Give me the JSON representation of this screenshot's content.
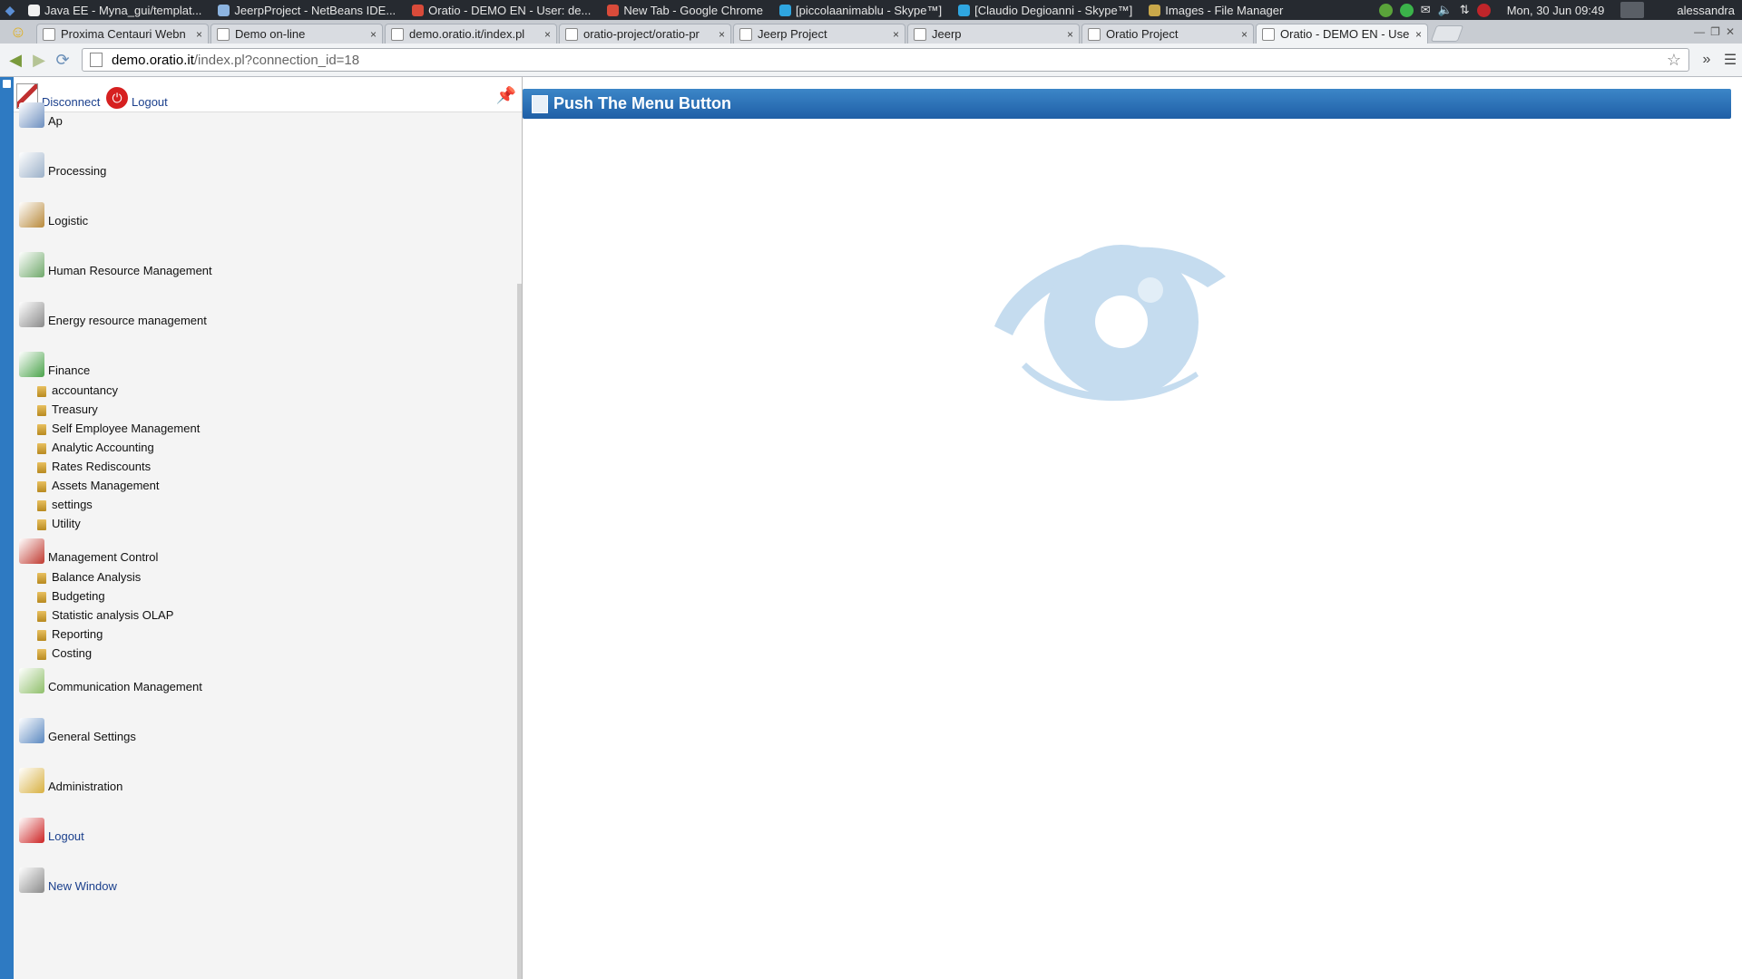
{
  "taskbar": {
    "tasks": [
      {
        "label": "Java EE - Myna_gui/templat...",
        "color": "#f0f0f0"
      },
      {
        "label": "JeerpProject - NetBeans IDE...",
        "color": "#8cb4e0"
      },
      {
        "label": "Oratio - DEMO EN - User: de...",
        "color": "#d94b3a"
      },
      {
        "label": "New Tab - Google Chrome",
        "color": "#d94b3a"
      },
      {
        "label": "[piccolaanimablu - Skype™]",
        "color": "#2fa6e0"
      },
      {
        "label": "[Claudio Degioanni - Skype™]",
        "color": "#2fa6e0"
      },
      {
        "label": "Images - File Manager",
        "color": "#c9a84a"
      }
    ],
    "clock": "Mon, 30 Jun  09:49",
    "user": "alessandra"
  },
  "browser": {
    "tabs": [
      {
        "title": "Proxima Centauri Webn",
        "active": false
      },
      {
        "title": "Demo on-line",
        "active": false
      },
      {
        "title": "demo.oratio.it/index.pl",
        "active": false
      },
      {
        "title": "oratio-project/oratio-pr",
        "active": false
      },
      {
        "title": "Jeerp Project",
        "active": false
      },
      {
        "title": "Jeerp",
        "active": false
      },
      {
        "title": "Oratio Project",
        "active": false
      },
      {
        "title": "Oratio - DEMO EN - Use",
        "active": true
      }
    ],
    "close_glyph": "×",
    "url_host": "demo.oratio.it",
    "url_path": "/index.pl?connection_id=18"
  },
  "sidebar": {
    "disconnect": "Disconnect",
    "logout_top": "Logout",
    "categories": [
      {
        "label": "Ap",
        "icon": "ap-icon",
        "color": "#6d8fbf",
        "subs": []
      },
      {
        "label": "Processing",
        "icon": "processing-icon",
        "color": "#9bb0c8",
        "subs": []
      },
      {
        "label": "Logistic",
        "icon": "logistic-icon",
        "color": "#b8893a",
        "subs": []
      },
      {
        "label": "Human Resource Management",
        "icon": "people-icon",
        "color": "#6fa86a",
        "subs": []
      },
      {
        "label": "Energy resource management",
        "icon": "energy-icon",
        "color": "#8a8a8a",
        "subs": []
      },
      {
        "label": "Finance",
        "icon": "finance-icon",
        "color": "#4aa34a",
        "subs": [
          "accountancy",
          "Treasury",
          "Self Employee Management",
          "Analytic Accounting",
          "Rates Rediscounts",
          "Assets Management",
          "settings",
          "Utility"
        ]
      },
      {
        "label": "Management Control",
        "icon": "management-control-icon",
        "color": "#c03a30",
        "subs": [
          "Balance Analysis",
          "Budgeting",
          "Statistic analysis OLAP",
          "Reporting",
          "Costing"
        ]
      },
      {
        "label": "Communication Management",
        "icon": "communication-icon",
        "color": "#8fbf6a",
        "subs": []
      },
      {
        "label": "General Settings",
        "icon": "settings-icon",
        "color": "#5a88c0",
        "subs": []
      },
      {
        "label": "Administration",
        "icon": "administration-icon",
        "color": "#d8b040",
        "subs": []
      },
      {
        "label": "Logout",
        "icon": "logout-icon",
        "color": "#cc2222",
        "subs": [],
        "link": true
      },
      {
        "label": "New Window",
        "icon": "new-window-icon",
        "color": "#8a8a8a",
        "subs": [],
        "link": true
      }
    ]
  },
  "main": {
    "header_title": "Push The Menu Button",
    "watermark": "eye-logo",
    "eye_color": "#c5dcef"
  }
}
